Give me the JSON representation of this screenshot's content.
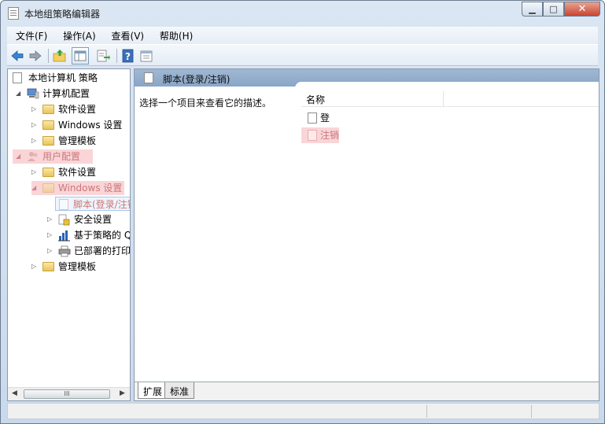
{
  "window": {
    "title": "本地组策略编辑器"
  },
  "menu": [
    "文件(F)",
    "操作(A)",
    "查看(V)",
    "帮助(H)"
  ],
  "toolbar": {
    "icons": [
      "back-arrow-icon",
      "forward-arrow-icon",
      "up-folder-icon",
      "show-hide-tree-icon",
      "export-list-icon",
      "help-icon",
      "properties-icon"
    ]
  },
  "tree": {
    "root": "本地计算机 策略",
    "computer_config": "计算机配置",
    "software_settings_1": "软件设置",
    "windows_settings_1": "Windows 设置",
    "admin_templates_1": "管理模板",
    "user_config": "用户配置",
    "software_settings_2": "软件设置",
    "windows_settings_2": "Windows 设置",
    "scripts": "脚本(登录/注销",
    "security_settings": "安全设置",
    "policy_based_qos": "基于策略的 Q",
    "deployed_printers": "已部署的打印",
    "admin_templates_2": "管理模板",
    "scrollbar_thumb": "III"
  },
  "content": {
    "header": "脚本(登录/注销)",
    "description": "选择一个项目来查看它的描述。",
    "list_header": "名称",
    "items": [
      "登录",
      "注销"
    ]
  },
  "tabs": [
    "扩展",
    "标准"
  ],
  "colors": {
    "highlight": "#f9d5d8",
    "header": "#8aa6c6"
  }
}
